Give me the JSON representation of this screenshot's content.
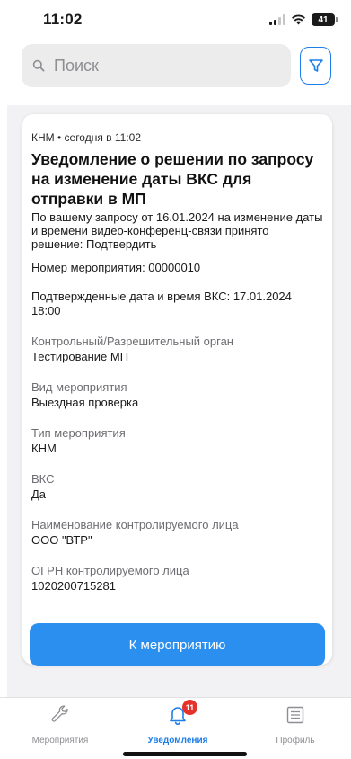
{
  "status_bar": {
    "time": "11:02",
    "battery": "41"
  },
  "search": {
    "placeholder": "Поиск"
  },
  "notification": {
    "meta": "КНМ • сегодня в 11:02",
    "title": "Уведомление о решении по запросу на изменение даты ВКС для отправки в МП",
    "lead": "По вашему запросу от 16.01.2024 на изменение даты и времени видео-конференц-связи принято решение: Подтвердить",
    "event_number": "Номер мероприятия: 00000010",
    "confirmed_datetime": "Подтвержденные дата и время ВКС: 17.01.2024 18:00",
    "fields": [
      {
        "label": "Контрольный/Разрешительный орган",
        "value": "Тестирование МП"
      },
      {
        "label": "Вид мероприятия",
        "value": "Выездная проверка"
      },
      {
        "label": "Тип мероприятия",
        "value": "КНМ"
      },
      {
        "label": "ВКС",
        "value": "Да"
      },
      {
        "label": "Наименование контролируемого лица",
        "value": "ООО \"ВТР\""
      },
      {
        "label": "ОГРН контролируемого лица",
        "value": "1020200715281"
      }
    ],
    "action_label": "К мероприятию"
  },
  "tabbar": {
    "tabs": [
      {
        "label": "Мероприятия",
        "icon": "wrench-icon"
      },
      {
        "label": "Уведомления",
        "icon": "bell-icon",
        "badge": "11"
      },
      {
        "label": "Профиль",
        "icon": "list-icon"
      }
    ]
  },
  "colors": {
    "accent": "#2b8ff0",
    "badge": "#e5322d",
    "search_bg": "#ececec"
  }
}
